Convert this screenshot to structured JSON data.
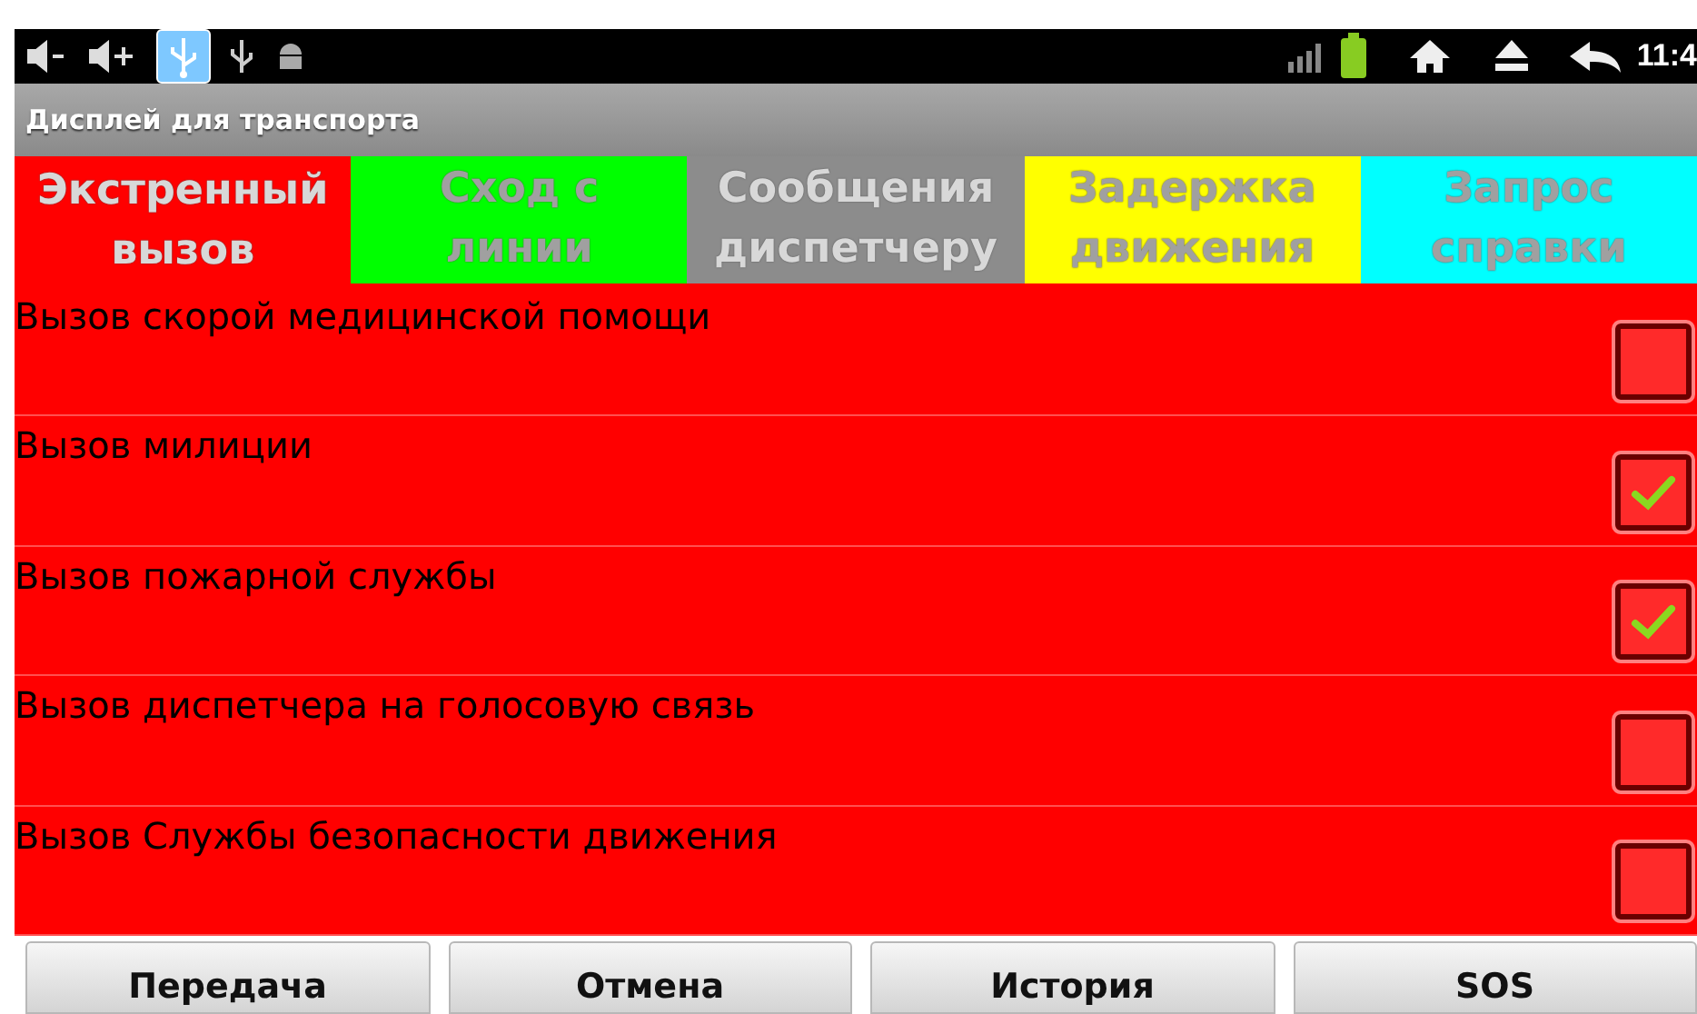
{
  "status_bar": {
    "time": "11:4"
  },
  "window": {
    "title": "Дисплей для транспорта"
  },
  "tabs": [
    {
      "label": "Экстренный вызов",
      "color": "#ff0000",
      "selected": true
    },
    {
      "label": "Сход с линии",
      "color": "#00ff00",
      "selected": false
    },
    {
      "label": "Сообщения диспетчеру",
      "color": "#8c8c8c",
      "selected": false
    },
    {
      "label": "Задержка движения",
      "color": "#ffff00",
      "selected": false
    },
    {
      "label": "Запрос справки",
      "color": "#00ffff",
      "selected": false
    }
  ],
  "items": [
    {
      "label": "Вызов скорой медицинской помощи",
      "checked": false
    },
    {
      "label": "Вызов милиции",
      "checked": true
    },
    {
      "label": "Вызов пожарной службы",
      "checked": true
    },
    {
      "label": "Вызов диспетчера на голосовую связь",
      "checked": false
    },
    {
      "label": "Вызов Службы безопасности движения",
      "checked": false
    }
  ],
  "buttons": [
    "Передача",
    "Отмена",
    "История",
    "SOS"
  ]
}
